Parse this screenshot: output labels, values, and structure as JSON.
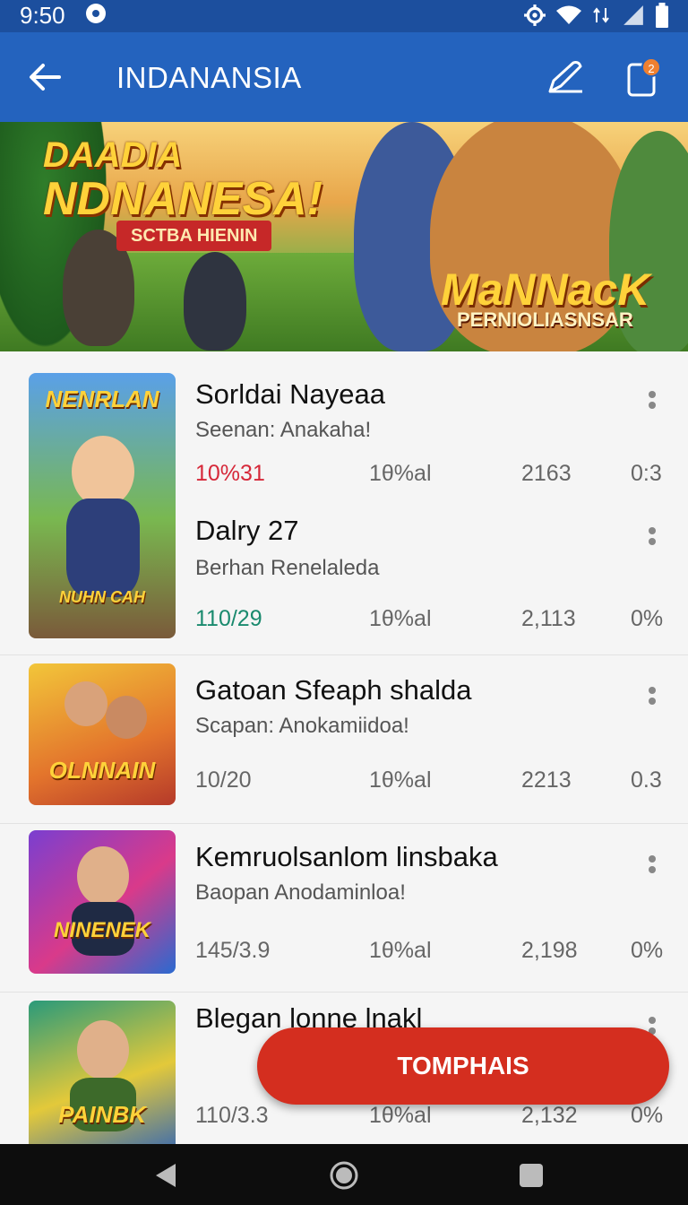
{
  "status_bar": {
    "time": "9:50"
  },
  "app_bar": {
    "title": "INDANANSIA",
    "notification_count": "2"
  },
  "banner": {
    "title_line1": "DAADIA",
    "title_line2": "NDNANESA!",
    "ribbon": "SCTBA HIENIN",
    "sub_title": "MaNNacK",
    "sub_ribbon": "PERNIOLIASNSAR"
  },
  "items": [
    {
      "thumb_label": "NENRLAN",
      "thumb_footer": "NUHN CAH",
      "title": "Sorldai Nayeaa",
      "subtitle": "Seenan: Anakaha!",
      "stats": [
        "10%31",
        "1θ%al",
        "2163",
        "0:3"
      ],
      "first_stat_color": "#d62839"
    },
    {
      "title": "Dalry  27",
      "subtitle": "Berhan Renelaleda",
      "stats": [
        "110/29",
        "1θ%al",
        "2,113",
        "0%"
      ],
      "first_stat_color": "#1a8a6e"
    },
    {
      "thumb_label": "OLNNAIN",
      "title": "Gatoan Sfeaph shalda",
      "subtitle": "Scapan: Anokamiidoa!",
      "stats": [
        "10/20",
        "1θ%al",
        "2213",
        "0.3"
      ]
    },
    {
      "thumb_label": "NINENEK",
      "title": "Kemruolsanlom linsbaka",
      "subtitle": "Baopan Anodaminloa!",
      "stats": [
        "145/3.9",
        "1θ%al",
        "2,198",
        "0%"
      ]
    },
    {
      "thumb_label": "PAINBK",
      "title": "Blegan lonne lnakl",
      "stats": [
        "110/3.3",
        "1θ%al",
        "2,132",
        "0%"
      ]
    }
  ],
  "fab": {
    "label": "TOMPHAIS"
  },
  "colors": {
    "status_bar": "#1c4f9e",
    "app_bar": "#2463be",
    "fab": "#d42e1f"
  }
}
